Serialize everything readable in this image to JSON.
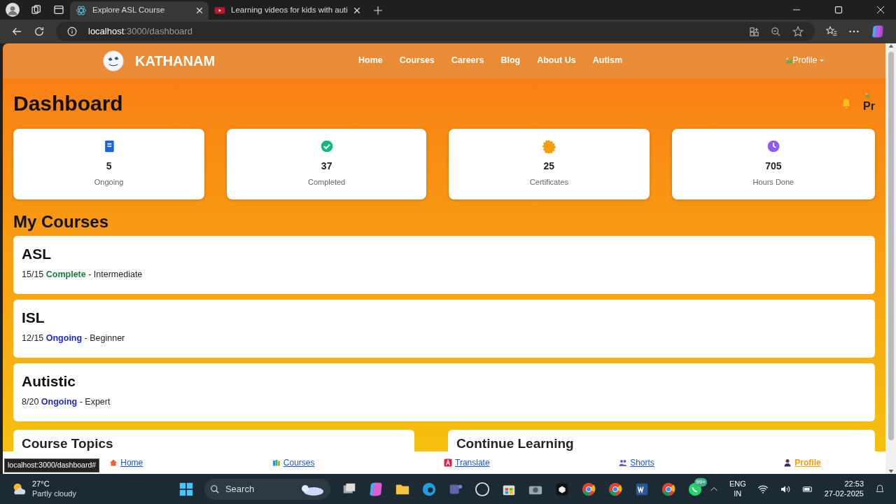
{
  "browser": {
    "tabs": [
      {
        "title": "Explore ASL Course",
        "selected": true
      },
      {
        "title": "Learning videos for kids with auti",
        "selected": false
      }
    ],
    "address": {
      "host": "localhost",
      "path": ":3000/dashboard"
    }
  },
  "navbar": {
    "brand": "KATHANAM",
    "links": [
      "Home",
      "Courses",
      "Careers",
      "Blog",
      "About Us",
      "Autism"
    ],
    "profile": "Profile"
  },
  "dashboard": {
    "title": "Dashboard",
    "avatar_text": "Pr",
    "stats": [
      {
        "kind": "book",
        "value": "5",
        "label": "Ongoing",
        "color": "#1e63d6"
      },
      {
        "kind": "check",
        "value": "37",
        "label": "Completed",
        "color": "#10b981"
      },
      {
        "kind": "badge",
        "value": "25",
        "label": "Certificates",
        "color": "#f59e0b"
      },
      {
        "kind": "clock",
        "value": "705",
        "label": "Hours Done",
        "color": "#8b5cf6"
      }
    ]
  },
  "my_courses": {
    "title": "My Courses",
    "courses": [
      {
        "name": "ASL",
        "progress": "15/15",
        "status": "Complete",
        "kind": "complete",
        "level": "- Intermediate"
      },
      {
        "name": "ISL",
        "progress": "12/15",
        "status": "Ongoing",
        "kind": "ongoing",
        "level": "- Beginner"
      },
      {
        "name": "Autistic",
        "progress": "8/20",
        "status": "Ongoing",
        "kind": "ongoing",
        "level": "- Expert"
      }
    ]
  },
  "panels": [
    "Course Topics",
    "Continue Learning"
  ],
  "bottom_nav": [
    {
      "kind": "home",
      "label": "Home",
      "selected": false
    },
    {
      "kind": "books",
      "label": "Courses",
      "selected": false
    },
    {
      "kind": "translate",
      "label": "Translate",
      "selected": false
    },
    {
      "kind": "people",
      "label": "Shorts",
      "selected": false
    },
    {
      "kind": "person",
      "label": "Profile",
      "selected": true
    }
  ],
  "status_url": "localhost:3000/dashboard#",
  "taskbar": {
    "temperature": "27°C",
    "weather": "Partly cloudy",
    "search": "Search",
    "badge": "99+",
    "language": "ENG",
    "region": "IN",
    "time": "22:53",
    "date": "27-02-2025"
  }
}
